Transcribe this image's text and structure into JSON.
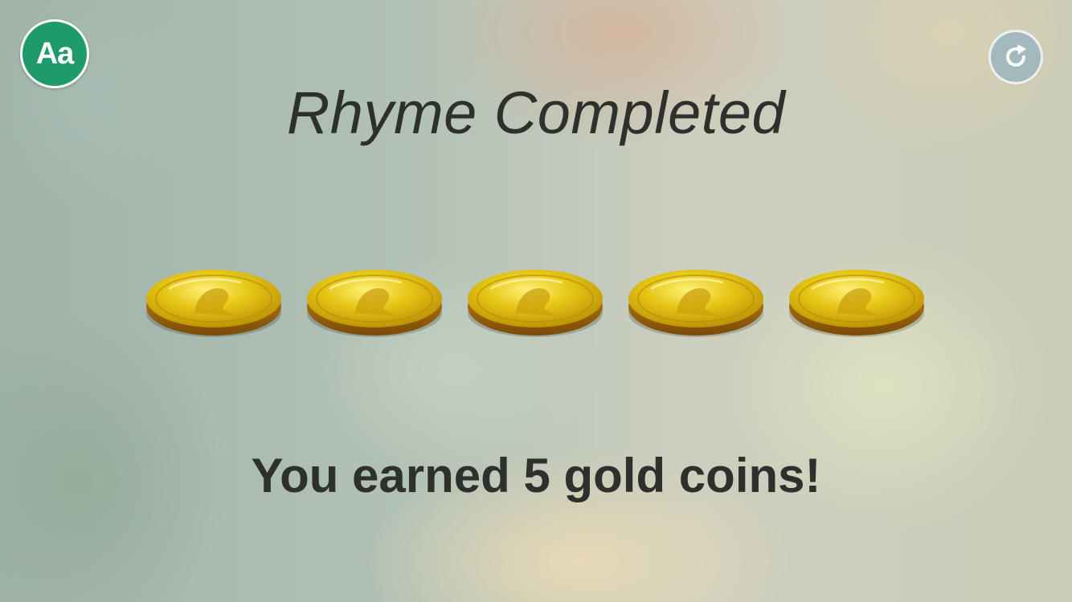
{
  "font_button": {
    "label": "Aa",
    "icon": "font-size-icon"
  },
  "replay_button": {
    "icon": "replay-icon"
  },
  "title": "Rhyme Completed",
  "coins": {
    "count": 5,
    "icon": "gold-coin-icon"
  },
  "message": "You earned 5 gold coins!",
  "colors": {
    "font_button_bg": "#1f9a6a",
    "replay_button_bg": "#9fb7bf",
    "text": "#2e302d",
    "coin_gold": "#e3c20c"
  }
}
